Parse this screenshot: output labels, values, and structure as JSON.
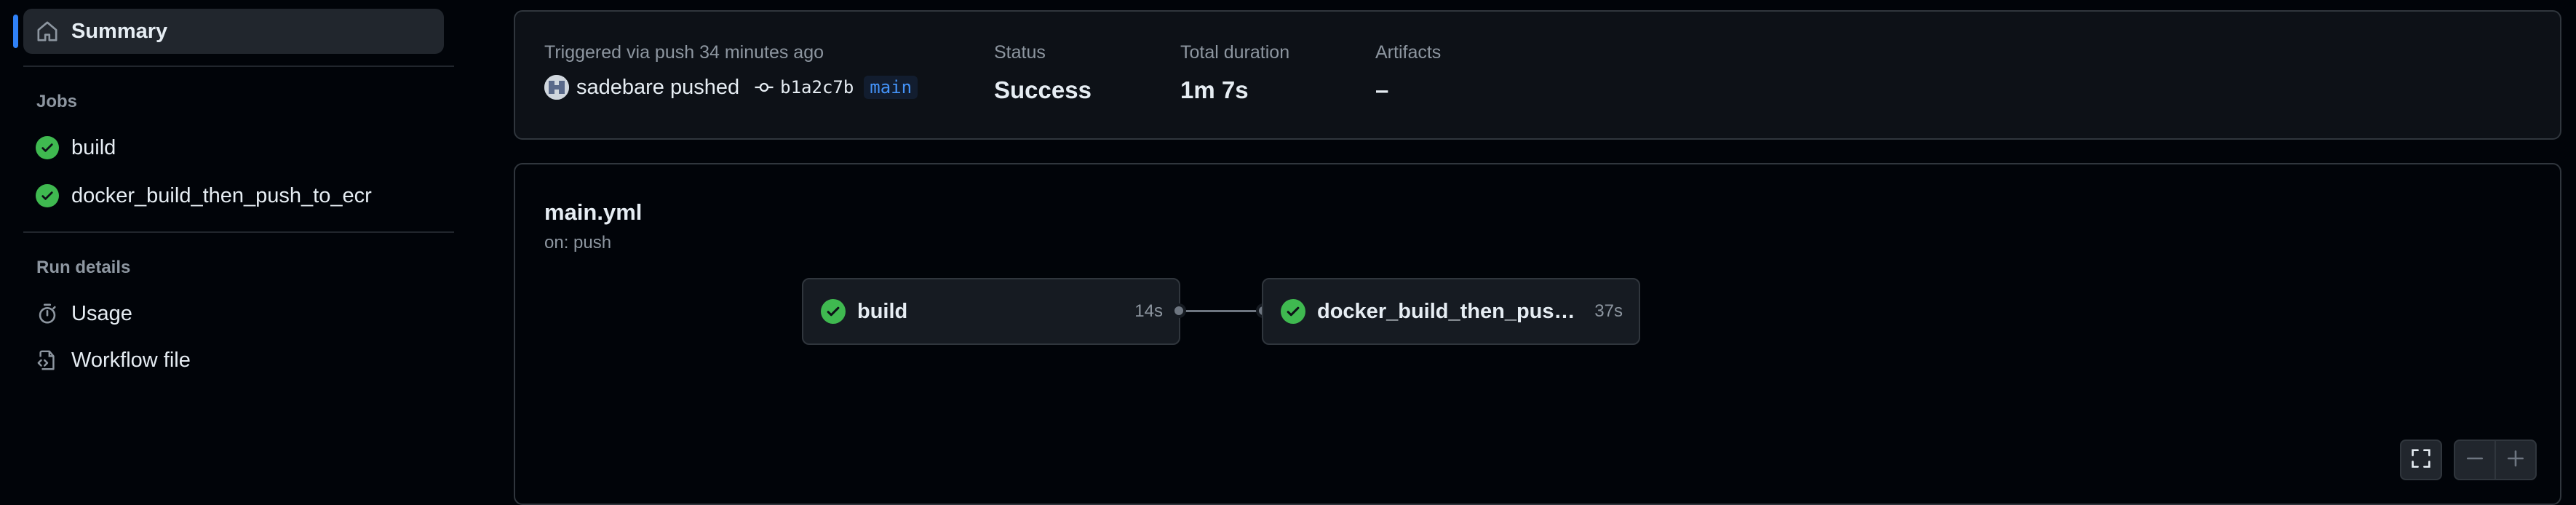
{
  "sidebar": {
    "summary_label": "Summary",
    "jobs_heading": "Jobs",
    "jobs": [
      {
        "label": "build",
        "status": "success"
      },
      {
        "label": "docker_build_then_push_to_ecr",
        "status": "success"
      }
    ],
    "run_details_heading": "Run details",
    "run_details": [
      {
        "label": "Usage",
        "icon": "stopwatch-icon"
      },
      {
        "label": "Workflow file",
        "icon": "file-code-icon"
      }
    ]
  },
  "summary": {
    "trigger_text": "Triggered via push 34 minutes ago",
    "actor": "sadebare pushed",
    "commit_sha": "b1a2c7b",
    "branch": "main",
    "status_label": "Status",
    "status_value": "Success",
    "duration_label": "Total duration",
    "duration_value": "1m 7s",
    "artifacts_label": "Artifacts",
    "artifacts_value": "–"
  },
  "workflow": {
    "file_name": "main.yml",
    "trigger": "on: push",
    "jobs": [
      {
        "name": "build",
        "duration": "14s",
        "status": "success"
      },
      {
        "name": "docker_build_then_push_to_ecr",
        "duration": "37s",
        "status": "success"
      }
    ]
  },
  "colors": {
    "success": "#3fb950",
    "accent": "#2f81f7",
    "branch_text": "#4493f8"
  }
}
